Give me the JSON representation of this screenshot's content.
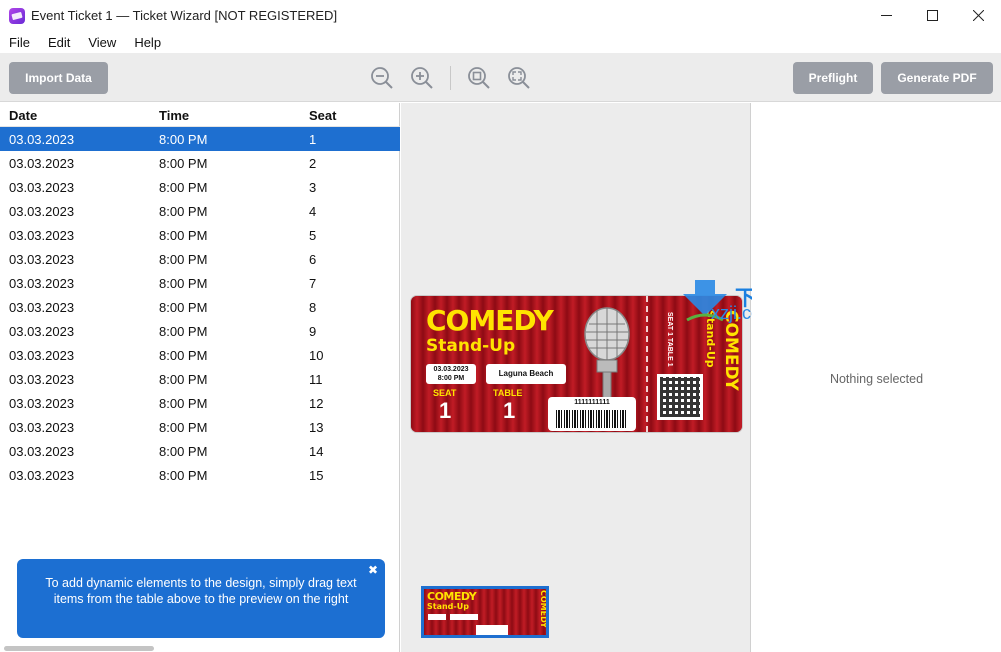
{
  "window": {
    "title": "Event Ticket 1 — Ticket Wizard [NOT REGISTERED]",
    "controls": {
      "minimize": "—",
      "maximize": "☐",
      "close": "✕"
    }
  },
  "menu": [
    "File",
    "Edit",
    "View",
    "Help"
  ],
  "toolbar": {
    "import_label": "Import Data",
    "preflight_label": "Preflight",
    "generate_label": "Generate PDF",
    "icons": [
      "zoom-out-icon",
      "zoom-in-icon",
      "zoom-actual-icon",
      "zoom-fit-icon"
    ]
  },
  "table": {
    "headers": {
      "date": "Date",
      "time": "Time",
      "seat": "Seat"
    },
    "selected_index": 0,
    "rows": [
      {
        "date": "03.03.2023",
        "time": "8:00 PM",
        "seat": "1"
      },
      {
        "date": "03.03.2023",
        "time": "8:00 PM",
        "seat": "2"
      },
      {
        "date": "03.03.2023",
        "time": "8:00 PM",
        "seat": "3"
      },
      {
        "date": "03.03.2023",
        "time": "8:00 PM",
        "seat": "4"
      },
      {
        "date": "03.03.2023",
        "time": "8:00 PM",
        "seat": "5"
      },
      {
        "date": "03.03.2023",
        "time": "8:00 PM",
        "seat": "6"
      },
      {
        "date": "03.03.2023",
        "time": "8:00 PM",
        "seat": "7"
      },
      {
        "date": "03.03.2023",
        "time": "8:00 PM",
        "seat": "8"
      },
      {
        "date": "03.03.2023",
        "time": "8:00 PM",
        "seat": "9"
      },
      {
        "date": "03.03.2023",
        "time": "8:00 PM",
        "seat": "10"
      },
      {
        "date": "03.03.2023",
        "time": "8:00 PM",
        "seat": "11"
      },
      {
        "date": "03.03.2023",
        "time": "8:00 PM",
        "seat": "12"
      },
      {
        "date": "03.03.2023",
        "time": "8:00 PM",
        "seat": "13"
      },
      {
        "date": "03.03.2023",
        "time": "8:00 PM",
        "seat": "14"
      },
      {
        "date": "03.03.2023",
        "time": "8:00 PM",
        "seat": "15"
      }
    ]
  },
  "tip": {
    "text": "To add dynamic elements to the design, simply drag text items from the table above to the preview on the right",
    "close": "✖"
  },
  "ticket": {
    "title": "COMEDY",
    "subtitle": "Stand-Up",
    "date": "03.03.2023",
    "time": "8:00 PM",
    "venue": "Laguna Beach",
    "seat_label": "SEAT",
    "seat_value": "1",
    "table_label": "TABLE",
    "table_value": "1",
    "barcode": "1111111111",
    "stub_info": "SEAT 1  TABLE 1"
  },
  "thumbnail": {
    "title": "COMEDY",
    "subtitle": "Stand-Up"
  },
  "watermark": {
    "cn": "下载集",
    "url": "xzji.com"
  },
  "properties": {
    "empty_text": "Nothing selected"
  },
  "colors": {
    "selection": "#1e6fd0",
    "toolbar_button": "#9a9ea6",
    "ticket_red": "#a3121c",
    "ticket_yellow": "#ffe400"
  }
}
